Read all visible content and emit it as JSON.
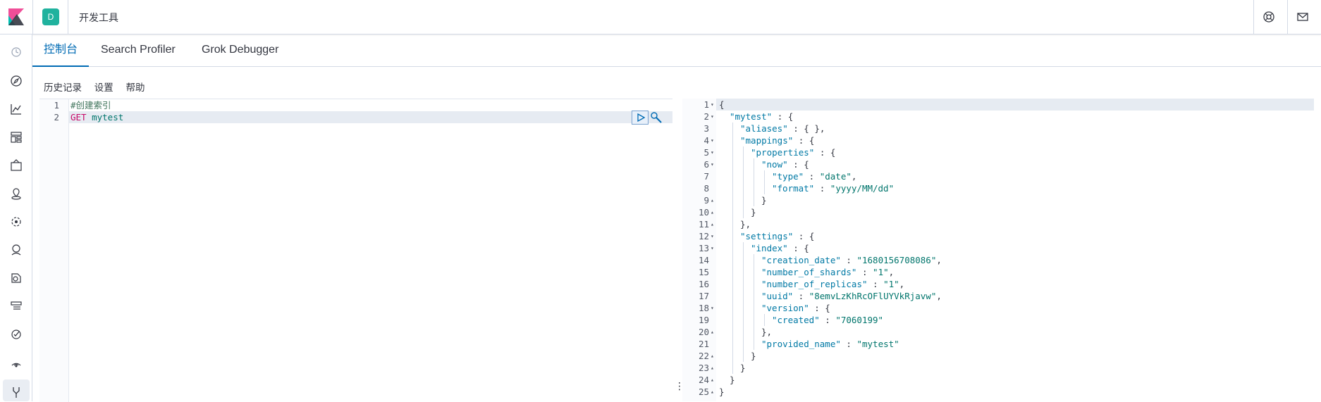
{
  "header": {
    "space_initial": "D",
    "app_title": "开发工具",
    "help_icon": "help-icon",
    "mail_icon": "mail-icon"
  },
  "tabs": [
    {
      "label": "控制台",
      "active": true
    },
    {
      "label": "Search Profiler",
      "active": false
    },
    {
      "label": "Grok Debugger",
      "active": false
    }
  ],
  "toolbar": {
    "history": "历史记录",
    "settings": "设置",
    "help": "帮助"
  },
  "request_editor": {
    "lines": [
      {
        "num": "1",
        "text": "#创建索引"
      },
      {
        "num": "2",
        "method": "GET",
        "path": "mytest"
      }
    ]
  },
  "response_editor": {
    "lines": [
      {
        "num": "1",
        "fold": "▾",
        "indent": 0,
        "content": "{"
      },
      {
        "num": "2",
        "fold": "▾",
        "indent": 1,
        "key": "\"mytest\"",
        "content": " : {"
      },
      {
        "num": "3",
        "fold": "",
        "indent": 2,
        "key": "\"aliases\"",
        "content": " : { },"
      },
      {
        "num": "4",
        "fold": "▾",
        "indent": 2,
        "key": "\"mappings\"",
        "content": " : {"
      },
      {
        "num": "5",
        "fold": "▾",
        "indent": 3,
        "key": "\"properties\"",
        "content": " : {"
      },
      {
        "num": "6",
        "fold": "▾",
        "indent": 4,
        "key": "\"now\"",
        "content": " : {"
      },
      {
        "num": "7",
        "fold": "",
        "indent": 5,
        "key": "\"type\"",
        "content": " : ",
        "value": "\"date\"",
        "tail": ","
      },
      {
        "num": "8",
        "fold": "",
        "indent": 5,
        "key": "\"format\"",
        "content": " : ",
        "value": "\"yyyy/MM/dd\"",
        "tail": ""
      },
      {
        "num": "9",
        "fold": "▴",
        "indent": 4,
        "content": "}"
      },
      {
        "num": "10",
        "fold": "▴",
        "indent": 3,
        "content": "}"
      },
      {
        "num": "11",
        "fold": "▴",
        "indent": 2,
        "content": "},"
      },
      {
        "num": "12",
        "fold": "▾",
        "indent": 2,
        "key": "\"settings\"",
        "content": " : {"
      },
      {
        "num": "13",
        "fold": "▾",
        "indent": 3,
        "key": "\"index\"",
        "content": " : {"
      },
      {
        "num": "14",
        "fold": "",
        "indent": 4,
        "key": "\"creation_date\"",
        "content": " : ",
        "value": "\"1680156708086\"",
        "tail": ","
      },
      {
        "num": "15",
        "fold": "",
        "indent": 4,
        "key": "\"number_of_shards\"",
        "content": " : ",
        "value": "\"1\"",
        "tail": ","
      },
      {
        "num": "16",
        "fold": "",
        "indent": 4,
        "key": "\"number_of_replicas\"",
        "content": " : ",
        "value": "\"1\"",
        "tail": ","
      },
      {
        "num": "17",
        "fold": "",
        "indent": 4,
        "key": "\"uuid\"",
        "content": " : ",
        "value": "\"8emvLzKhRcOFlUYVkRjavw\"",
        "tail": ","
      },
      {
        "num": "18",
        "fold": "▾",
        "indent": 4,
        "key": "\"version\"",
        "content": " : {"
      },
      {
        "num": "19",
        "fold": "",
        "indent": 5,
        "key": "\"created\"",
        "content": " : ",
        "value": "\"7060199\"",
        "tail": ""
      },
      {
        "num": "20",
        "fold": "▴",
        "indent": 4,
        "content": "},"
      },
      {
        "num": "21",
        "fold": "",
        "indent": 4,
        "key": "\"provided_name\"",
        "content": " : ",
        "value": "\"mytest\"",
        "tail": ""
      },
      {
        "num": "22",
        "fold": "▴",
        "indent": 3,
        "content": "}"
      },
      {
        "num": "23",
        "fold": "▴",
        "indent": 2,
        "content": "}"
      },
      {
        "num": "24",
        "fold": "▴",
        "indent": 1,
        "content": "}"
      },
      {
        "num": "25",
        "fold": "▴",
        "indent": 0,
        "content": "}"
      }
    ]
  },
  "sidenav": {
    "icons": [
      "clock-icon",
      "compass-icon",
      "chart-icon",
      "dashboard-icon",
      "canvas-icon",
      "maps-icon",
      "ml-icon",
      "apm-icon",
      "uptime-icon",
      "logs-icon",
      "monitoring-icon",
      "siem-icon",
      "devtools-icon"
    ]
  },
  "colors": {
    "accent": "#006bb4",
    "space": "#20b29e"
  }
}
